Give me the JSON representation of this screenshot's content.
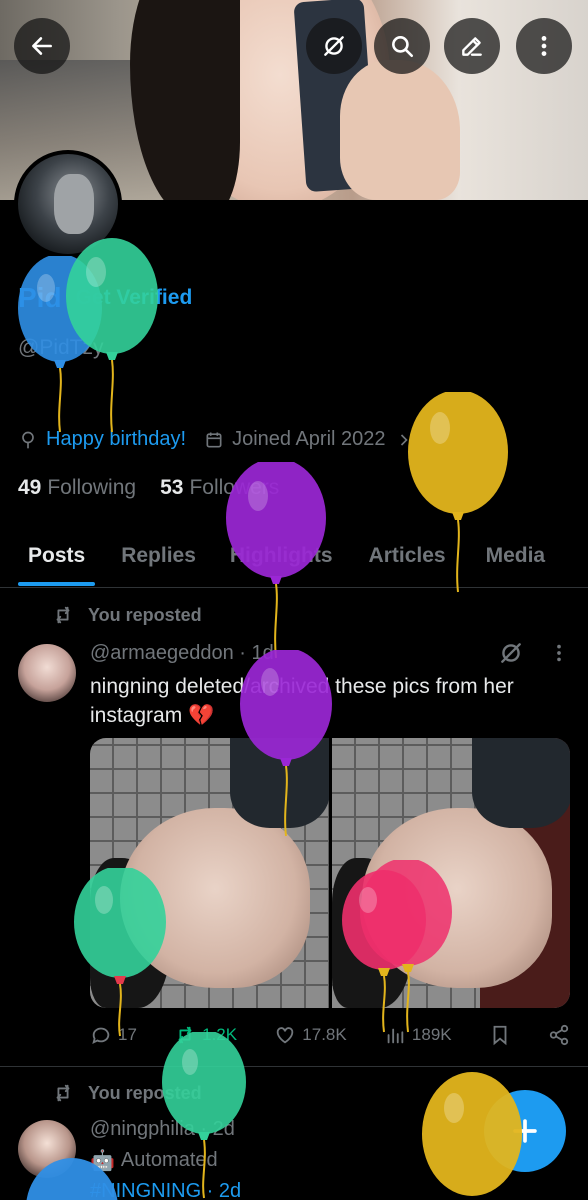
{
  "profile": {
    "display_name": "Pid",
    "get_verified_label": "Get Verified",
    "handle": "@PidTzy",
    "birthday_label": "Happy birthday!",
    "joined_label": "Joined April 2022",
    "following_count": "49",
    "following_label": "Following",
    "followers_count": "53",
    "followers_label": "Followers"
  },
  "tabs": [
    {
      "label": "Posts",
      "active": true
    },
    {
      "label": "Replies"
    },
    {
      "label": "Highlights"
    },
    {
      "label": "Articles"
    },
    {
      "label": "Media"
    }
  ],
  "posts": [
    {
      "repost_label": "You reposted",
      "header": "@armaegeddon · 1d",
      "text": "ningning deleted/archived these pics from her instagram 💔",
      "replies": "17",
      "reposts": "1.2K",
      "likes": "17.8K",
      "views": "189K"
    },
    {
      "repost_label": "You reposted",
      "header": "@ningphilia · 2d",
      "automated_label": "Automated",
      "next_line": "#NINGNING · 2d"
    }
  ],
  "icons": {
    "back": "back-arrow-icon",
    "grok": "grok-icon",
    "search": "search-icon",
    "edit": "edit-icon",
    "more": "more-vertical-icon",
    "compose": "plus-icon"
  },
  "colors": {
    "accent": "#1d9bf0",
    "repost_green": "#00ba7c",
    "muted": "#71767b",
    "balloon_blue": "#2f8fe6",
    "balloon_green": "#33d19a",
    "balloon_yellow": "#e3b51c",
    "balloon_purple": "#9b27d6",
    "balloon_pink": "#ee2f6c"
  }
}
